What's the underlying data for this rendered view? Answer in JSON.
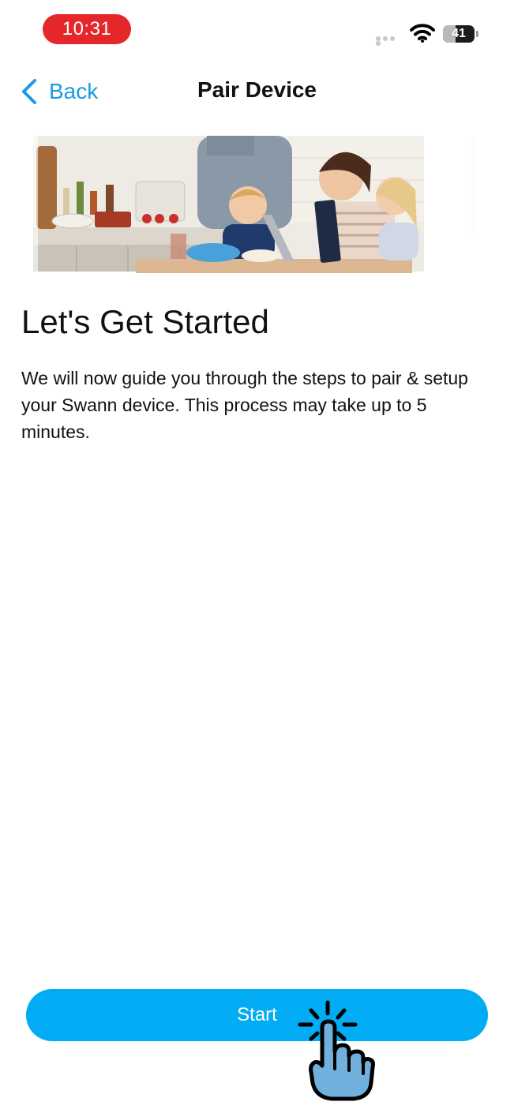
{
  "status_bar": {
    "time": "10:31",
    "battery_level": "41",
    "icons": [
      "signal-dots-icon",
      "wifi-icon",
      "battery-icon"
    ]
  },
  "nav": {
    "back_label": "Back",
    "title": "Pair Device",
    "back_icon": "chevron-left-icon"
  },
  "content": {
    "heading": "Let's Get Started",
    "description": "We will now guide you through the steps to pair & setup your Swann device. This process may take up to 5 minutes."
  },
  "actions": {
    "start_label": "Start"
  },
  "colors": {
    "accent": "#1a9be0",
    "button": "#02acf5",
    "time_pill": "#e5262a"
  }
}
